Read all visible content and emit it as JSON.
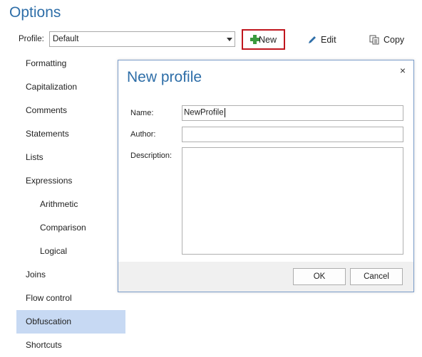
{
  "page": {
    "title": "Options"
  },
  "profile": {
    "label": "Profile:",
    "selected": "Default"
  },
  "toolbar": {
    "new_label": "New",
    "edit_label": "Edit",
    "copy_label": "Copy"
  },
  "sidebar": {
    "items": [
      {
        "label": "Formatting"
      },
      {
        "label": "Capitalization"
      },
      {
        "label": "Comments"
      },
      {
        "label": "Statements"
      },
      {
        "label": "Lists"
      },
      {
        "label": "Expressions"
      },
      {
        "label": "Arithmetic"
      },
      {
        "label": "Comparison"
      },
      {
        "label": "Logical"
      },
      {
        "label": "Joins"
      },
      {
        "label": "Flow control"
      },
      {
        "label": "Obfuscation"
      },
      {
        "label": "Shortcuts"
      }
    ],
    "selected": "Obfuscation"
  },
  "dialog": {
    "title": "New profile",
    "close": "×",
    "name_label": "Name:",
    "name_value": "NewProfile",
    "author_label": "Author:",
    "author_value": "",
    "description_label": "Description:",
    "ok_label": "OK",
    "cancel_label": "Cancel"
  },
  "colors": {
    "accent": "#2e6ea8",
    "highlight": "#c0161e",
    "selection": "#c7d9f3"
  }
}
